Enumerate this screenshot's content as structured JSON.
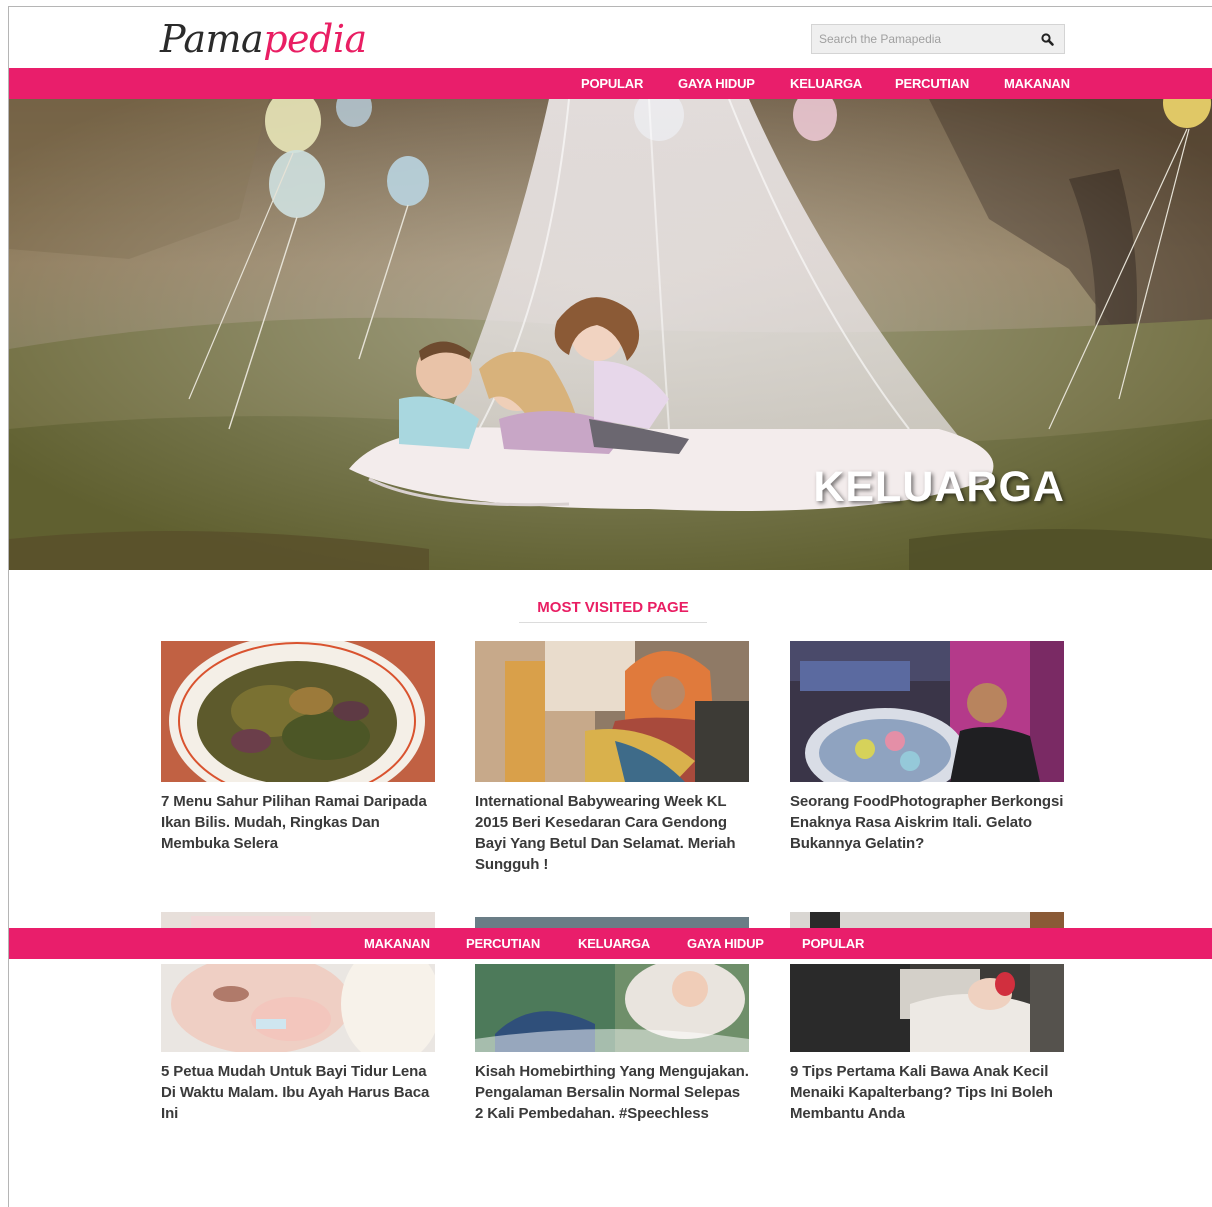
{
  "header": {
    "logo_dark": "Pama",
    "logo_pink": "pedia",
    "search_placeholder": "Search the Pamapedia"
  },
  "nav_top": [
    "POPULAR",
    "GAYA HIDUP",
    "KELUARGA",
    "PERCUTIAN",
    "MAKANAN"
  ],
  "nav_bottom": [
    "MAKANAN",
    "PERCUTIAN",
    "KELUARGA",
    "GAYA HIDUP",
    "POPULAR"
  ],
  "hero": {
    "label": "KELUARGA"
  },
  "section": {
    "title": "MOST VISITED PAGE"
  },
  "articles": [
    {
      "title": "7 Menu Sahur Pilihan Ramai Daripada Ikan Bilis. Mudah, Ringkas Dan Membuka Selera"
    },
    {
      "title": "International Babywearing Week KL 2015 Beri Kesedaran Cara Gendong Bayi Yang Betul Dan Selamat. Meriah Sungguh !"
    },
    {
      "title": "Seorang FoodPhotographer Berkongsi Enaknya Rasa Aiskrim Itali. Gelato Bukannya Gelatin?"
    },
    {
      "title": "5 Petua Mudah Untuk Bayi Tidur Lena Di Waktu Malam. Ibu Ayah Harus Baca Ini"
    },
    {
      "title": "Kisah Homebirthing Yang Mengujakan. Pengalaman Bersalin Normal Selepas 2 Kali Pembedahan. #Speechless"
    },
    {
      "title": "9 Tips Pertama Kali Bawa Anak Kecil Menaiki Kapalterbang? Tips Ini Boleh Membantu Anda"
    }
  ],
  "colors": {
    "brand_pink": "#e91e6b",
    "text_dark": "#3a3a3a"
  },
  "icons": {
    "search": "search-icon"
  }
}
